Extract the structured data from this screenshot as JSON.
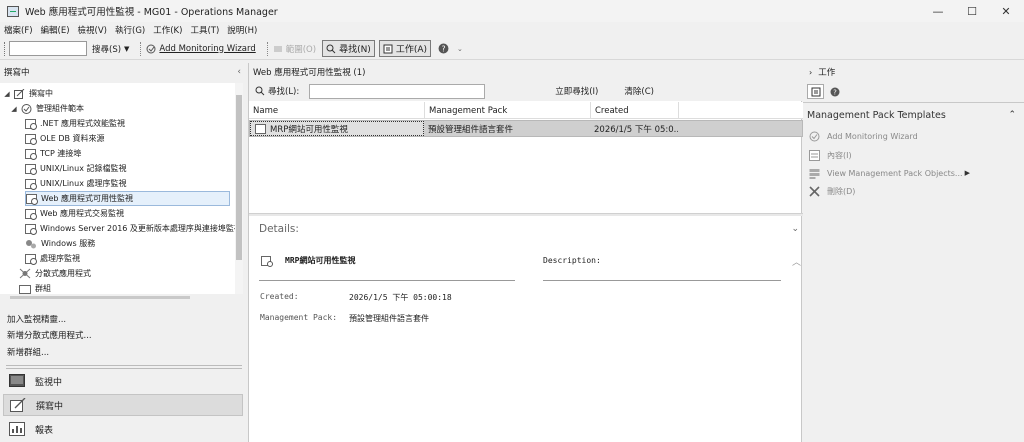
{
  "window": {
    "title": "Web 應用程式可用性監視 - MG01 - Operations Manager",
    "minimize": "—",
    "maximize": "☐",
    "close": "✕"
  },
  "menu": [
    "檔案(F)",
    "編輯(E)",
    "檢視(V)",
    "執行(G)",
    "工作(K)",
    "工具(T)",
    "說明(H)"
  ],
  "toolbar": {
    "search_label": "搜尋(S)",
    "add_wizard": "Add Monitoring Wizard",
    "scope_label": "範圍(O)",
    "find_label": "尋找(N)",
    "tasks_label": "工作(A)"
  },
  "left": {
    "header": "撰寫中",
    "tree": {
      "root": "撰寫中",
      "templates": "管理組件範本",
      "items": [
        ".NET 應用程式效能監視",
        "OLE DB 資料來源",
        "TCP 連接埠",
        "UNIX/Linux 記錄檔監視",
        "UNIX/Linux 處理序監視",
        "Web 應用程式可用性監視",
        "Web 應用程式交易監視",
        "Windows Server 2016 及更新版本處理序與連接埠監視",
        "Windows 服務",
        "處理序監視"
      ],
      "distributed": "分散式應用程式",
      "groups": "群組"
    },
    "links": [
      "加入監視精靈...",
      "新增分散式應用程式...",
      "新增群組..."
    ],
    "wunderbar": [
      "監視中",
      "撰寫中",
      "報表"
    ]
  },
  "middle": {
    "header": "Web 應用程式可用性監視 (1)",
    "find_label": "尋找(L):",
    "find_value": "",
    "find_now": "立即尋找(I)",
    "clear": "清除(C)",
    "columns": [
      "Name",
      "Management Pack",
      "Created"
    ],
    "rows": [
      {
        "name": "MRP網站可用性監視",
        "mp": "預設管理組件語言套件",
        "created": "2026/1/5 下午 05:0..."
      }
    ],
    "details": {
      "title": "Details:",
      "name": "MRP網站可用性監視",
      "description_label": "Description:",
      "description": "",
      "created_label": "Created:",
      "created": "2026/1/5 下午 05:00:18",
      "mp_label": "Management Pack:",
      "mp": "預設管理組件語言套件"
    }
  },
  "right": {
    "header": "工作",
    "section": "Management Pack Templates",
    "tasks": [
      "Add Monitoring Wizard",
      "內容(I)",
      "View Management Pack Objects...",
      "刪除(D)"
    ]
  },
  "colors": {
    "selection": "#cfcfcf",
    "pane_bg": "#f0f0f0",
    "link_disabled": "#888888"
  }
}
